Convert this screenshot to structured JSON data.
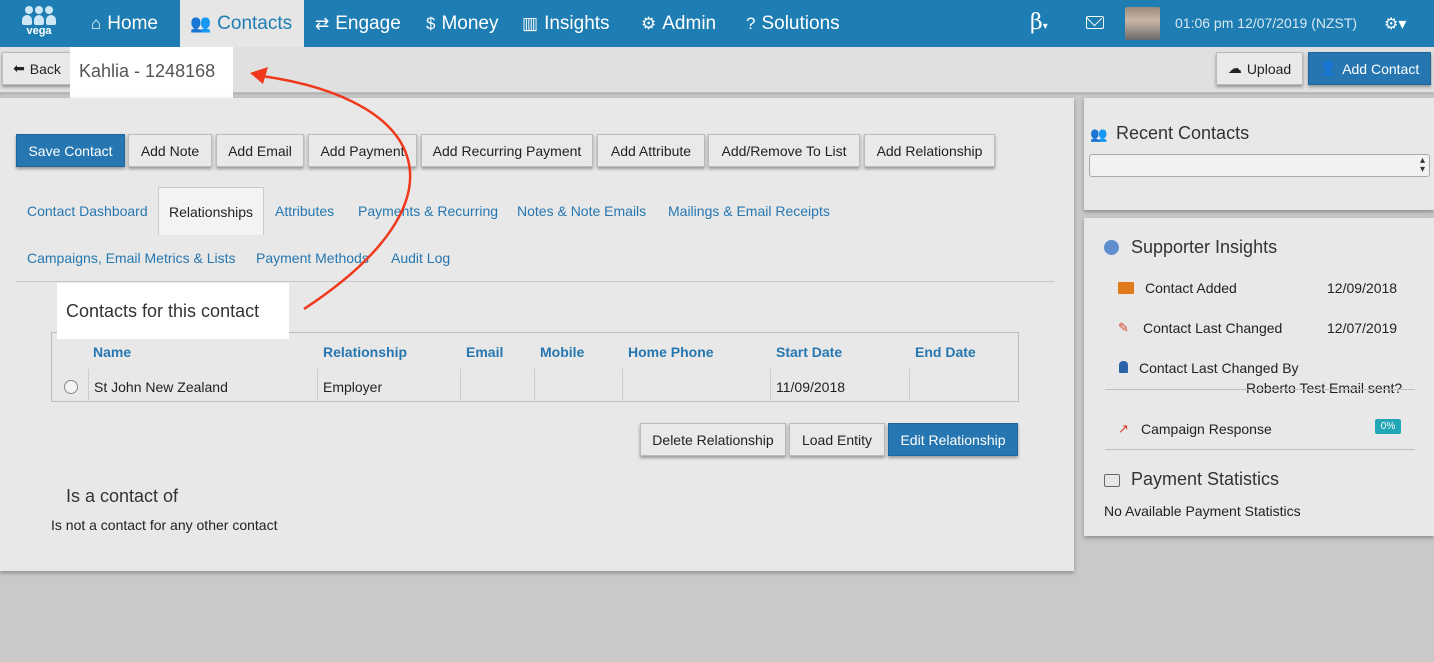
{
  "nav": {
    "logo_text": "vega",
    "items": [
      {
        "label": "Home",
        "icon": "home-icon"
      },
      {
        "label": "Contacts",
        "icon": "users-icon"
      },
      {
        "label": "Engage",
        "icon": "exchange-icon"
      },
      {
        "label": "Money",
        "icon": "dollar-icon"
      },
      {
        "label": "Insights",
        "icon": "bar-chart-icon"
      },
      {
        "label": "Admin",
        "icon": "cogs-icon"
      },
      {
        "label": "Solutions",
        "icon": "question-circle-icon"
      }
    ],
    "beta": "β",
    "datetime": "01:06 pm 12/07/2019 (NZST)"
  },
  "header": {
    "back_label": "Back",
    "title": "Kahlia - 1248168",
    "upload_label": "Upload",
    "add_contact_label": "Add Contact"
  },
  "actions": [
    "Save Contact",
    "Add Note",
    "Add Email",
    "Add Payment",
    "Add Recurring Payment",
    "Add Attribute",
    "Add/Remove To List",
    "Add Relationship"
  ],
  "tabs": [
    "Contact Dashboard",
    "Relationships",
    "Attributes",
    "Payments & Recurring",
    "Notes & Note Emails",
    "Mailings & Email Receipts",
    "Campaigns, Email Metrics & Lists",
    "Payment Methods",
    "Audit Log"
  ],
  "contacts_section": {
    "title": "Contacts for this contact",
    "columns": [
      "Name",
      "Relationship",
      "Email",
      "Mobile",
      "Home Phone",
      "Start Date",
      "End Date"
    ],
    "rows": [
      {
        "name": "St John New Zealand",
        "relationship": "Employer",
        "email": "",
        "mobile": "",
        "home_phone": "",
        "start_date": "11/09/2018",
        "end_date": ""
      }
    ],
    "buttons": [
      "Delete Relationship",
      "Load Entity",
      "Edit Relationship"
    ]
  },
  "contact_of": {
    "title": "Is a contact of",
    "empty_text": "Is not a contact for any other contact"
  },
  "recent": {
    "title": "Recent Contacts"
  },
  "insights": {
    "title": "Supporter Insights",
    "contact_added_label": "Contact Added",
    "contact_added_value": "12/09/2018",
    "last_changed_label": "Contact Last Changed",
    "last_changed_value": "12/07/2019",
    "last_changed_by_label": "Contact Last Changed By",
    "last_changed_by_value": "Roberto Test Email sent?",
    "campaign_label": "Campaign Response",
    "campaign_value": "0%"
  },
  "payment_stats": {
    "title": "Payment Statistics",
    "empty_text": "No Available Payment Statistics"
  },
  "colors": {
    "nav": "#1e7db3",
    "primary": "#2677b1",
    "annotation": "#f0391c"
  }
}
